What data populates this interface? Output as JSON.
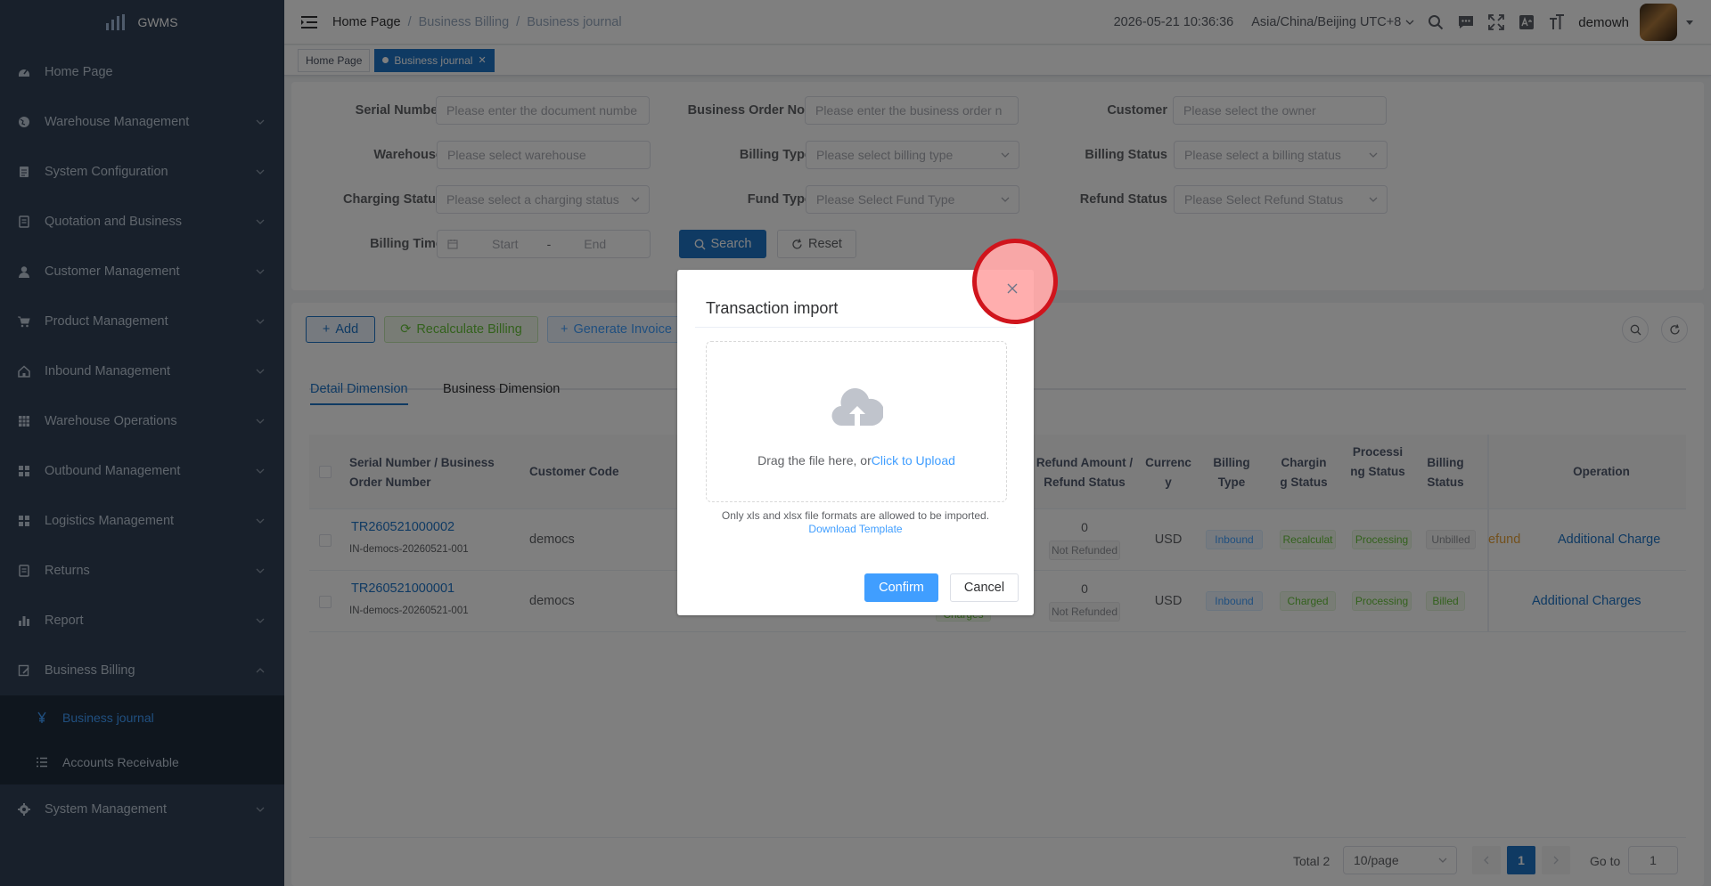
{
  "app": {
    "name": "GWMS"
  },
  "sidebar": {
    "items": [
      {
        "label": "Home Page",
        "icon": "dashboard-icon"
      },
      {
        "label": "Warehouse Management",
        "icon": "globe-icon"
      },
      {
        "label": "System Configuration",
        "icon": "document-icon"
      },
      {
        "label": "Quotation and Business",
        "icon": "quotation-icon"
      },
      {
        "label": "Customer Management",
        "icon": "user-icon"
      },
      {
        "label": "Product Management",
        "icon": "cart-icon"
      },
      {
        "label": "Inbound Management",
        "icon": "home-icon"
      },
      {
        "label": "Warehouse Operations",
        "icon": "grid-icon"
      },
      {
        "label": "Outbound Management",
        "icon": "apps-icon"
      },
      {
        "label": "Logistics Management",
        "icon": "apps-icon"
      },
      {
        "label": "Returns",
        "icon": "return-icon"
      },
      {
        "label": "Report",
        "icon": "chart-icon"
      },
      {
        "label": "Business Billing",
        "icon": "billing-icon"
      }
    ],
    "submenu": [
      {
        "label": "Business journal",
        "icon": "yen-icon"
      },
      {
        "label": "Accounts Receivable",
        "icon": "list-icon"
      }
    ],
    "system": {
      "label": "System Management",
      "icon": "gear-icon"
    }
  },
  "header": {
    "breadcrumb": [
      "Home Page",
      "Business Billing",
      "Business journal"
    ],
    "datetime": "2026-05-21 10:36:36",
    "timezone": "Asia/China/Beijing UTC+8",
    "user": "demowh"
  },
  "tags": [
    "Home Page",
    "Business journal"
  ],
  "filters": {
    "serial_number": {
      "label": "Serial Number",
      "placeholder": "Please enter the document numbe"
    },
    "business_order": {
      "label": "Business Order No.",
      "placeholder": "Please enter the business order n"
    },
    "customer": {
      "label": "Customer",
      "placeholder": "Please select the owner"
    },
    "warehouse": {
      "label": "Warehouse",
      "placeholder": "Please select warehouse"
    },
    "billing_type": {
      "label": "Billing Type",
      "placeholder": "Please select billing type"
    },
    "billing_status": {
      "label": "Billing Status",
      "placeholder": "Please select a billing status"
    },
    "charging_status": {
      "label": "Charging Status",
      "placeholder": "Please select a charging status"
    },
    "fund_type": {
      "label": "Fund Type",
      "placeholder": "Please Select Fund Type"
    },
    "refund_status": {
      "label": "Refund Status",
      "placeholder": "Please Select Refund Status"
    },
    "billing_time": {
      "label": "Billing Time",
      "start": "Start",
      "sep": "-",
      "end": "End"
    },
    "search": "Search",
    "reset": "Reset"
  },
  "toolbar": {
    "add": "Add",
    "recalculate": "Recalculate Billing",
    "generate": "Generate Invoice"
  },
  "tabs": [
    "Detail Dimension",
    "Business Dimension"
  ],
  "table": {
    "headers": {
      "serial": "Serial Number / Business Order Number",
      "customer_code": "Customer Code",
      "refund": "Refund Amount / Refund Status",
      "currency": "Currenc y",
      "billing_type": "Billing Type",
      "charging_status": "Chargin g Status",
      "processing_status": "Processi ng Status",
      "billing_status": "Billing Status",
      "operation": "Operation"
    },
    "rows": [
      {
        "serial": "TR260521000002",
        "order": "IN-democs-20260521-001",
        "customer_code": "democs",
        "refund_amount": "0",
        "refund_status": "Not Refunded",
        "currency": "USD",
        "billing_type": "Inbound",
        "charging_status": "Recalculat",
        "processing_status": "Processing",
        "billing_status": "Unbilled",
        "op_partial": "efund",
        "op": "Additional Charge"
      },
      {
        "serial": "TR260521000001",
        "order": "IN-democs-20260521-001",
        "customer_code": "democs",
        "refund_amount": "0",
        "refund_status": "Not Refunded",
        "currency": "USD",
        "billing_type": "Inbound",
        "charging_status": "Charged",
        "processing_status": "Processing",
        "billing_status": "Billed",
        "hidden_fragment": "Charges",
        "op": "Additional Charges"
      }
    ]
  },
  "pagination": {
    "total": "Total 2",
    "page_size": "10/page",
    "current": "1",
    "goto_label": "Go to",
    "goto_value": "1"
  },
  "dialog": {
    "title": "Transaction import",
    "drop_text": "Drag the file here, or",
    "upload_link": "Click to Upload",
    "tip": "Only xls and xlsx file formats are allowed to be imported.",
    "template_link": "Download Template",
    "confirm": "Confirm",
    "cancel": "Cancel"
  },
  "colors": {
    "primary": "#1f74c7",
    "sidebar": "#304156",
    "highlight": "#d0141c"
  }
}
